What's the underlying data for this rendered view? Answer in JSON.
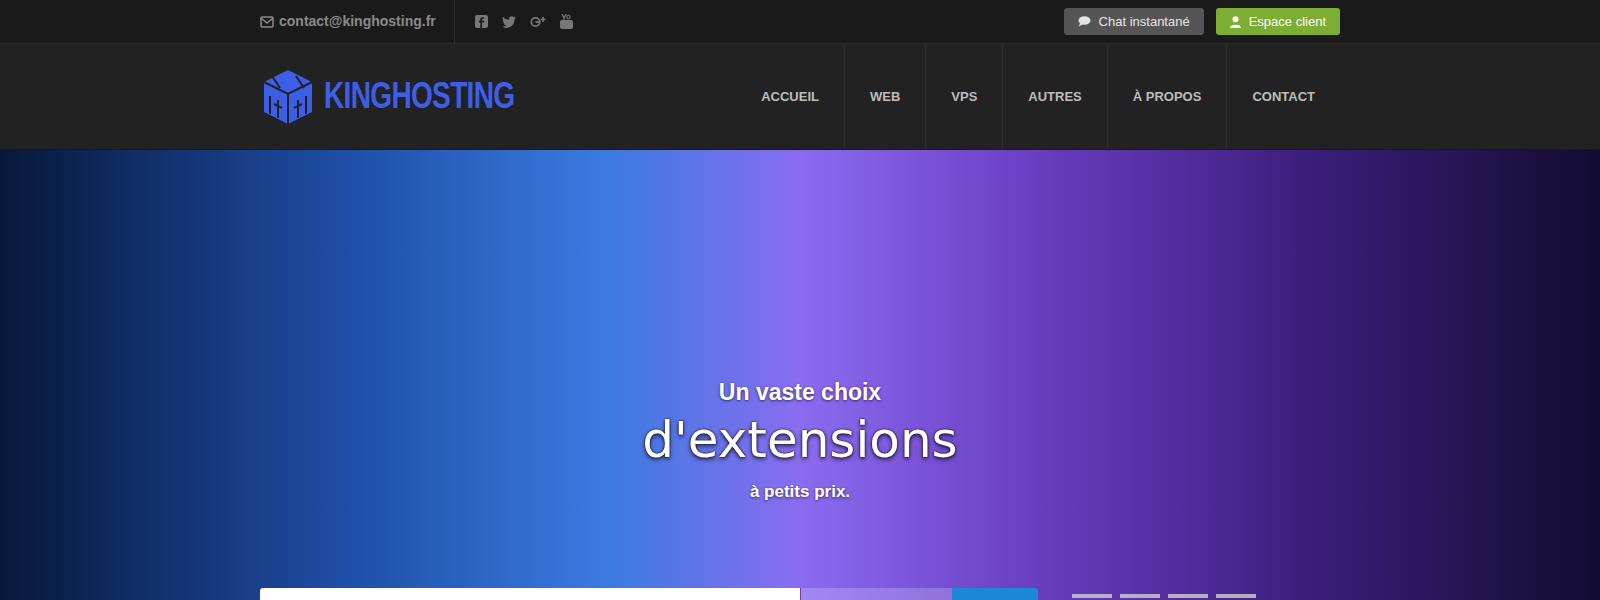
{
  "top_bar": {
    "email": "contact@kinghosting.fr",
    "buttons": [
      {
        "label": "Chat instantané",
        "kind": "chat"
      },
      {
        "label": "Espace client",
        "kind": "client"
      }
    ]
  },
  "logo": {
    "text": "KINGHOSTING"
  },
  "nav": {
    "items": [
      {
        "label": "ACCUEIL",
        "selected": false
      },
      {
        "label": "WEB",
        "selected": false
      },
      {
        "label": "VPS",
        "selected": false
      },
      {
        "label": "AUTRES",
        "selected": false
      },
      {
        "label": "À PROPOS",
        "selected": false
      },
      {
        "label": "CONTACT",
        "selected": false
      }
    ]
  },
  "hero": {
    "line1": "Un vaste choix",
    "line2": "d'extensions",
    "line3": "à petits prix."
  }
}
